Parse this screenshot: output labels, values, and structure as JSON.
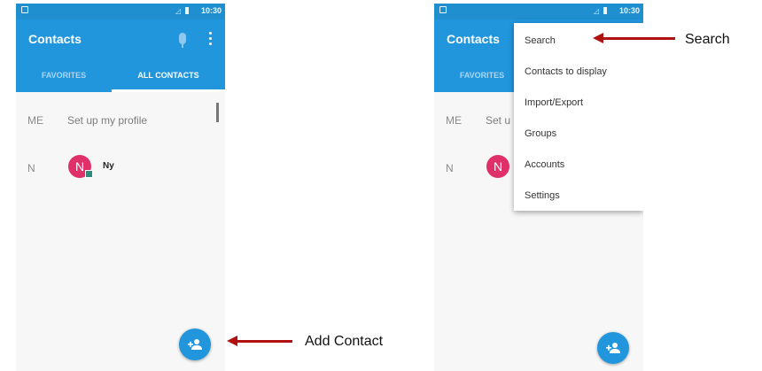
{
  "status_bar": {
    "time": "10:30"
  },
  "app_bar": {
    "title": "Contacts"
  },
  "tabs": {
    "favorites": "FAVORITES",
    "all_contacts": "ALL CONTACTS"
  },
  "contacts": {
    "profile_letter": "ME",
    "profile_text": "Set up my profile",
    "section_letter": "N",
    "avatar_initial": "N",
    "contact_name": "Ny",
    "profile_text_truncated": "Set u"
  },
  "overflow_menu": {
    "items": [
      "Search",
      "Contacts to display",
      "Import/Export",
      "Groups",
      "Accounts",
      "Settings"
    ]
  },
  "annotations": {
    "add_contact": "Add Contact",
    "search": "Search"
  },
  "colors": {
    "primary": "#2196dd",
    "status_bar": "#1f8fd0",
    "avatar": "#e0306a",
    "arrow": "#b01212"
  }
}
